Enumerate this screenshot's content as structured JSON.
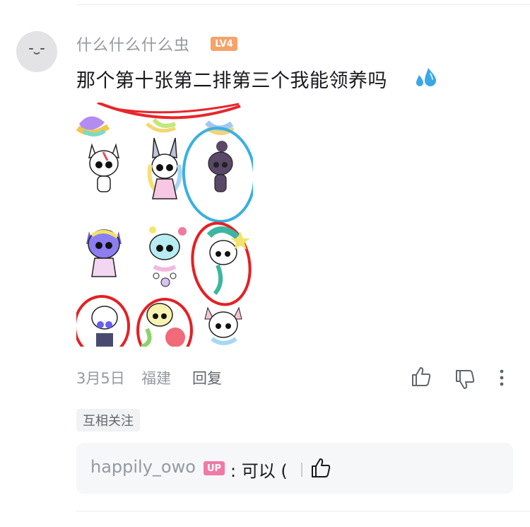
{
  "comment": {
    "username": "什么什么什么虫",
    "level_badge": "LV4",
    "text": "那个第十张第二排第三个我能领养吗",
    "emoji": "sweat-droplets",
    "date": "3月5日",
    "location": "福建",
    "reply_label": "回复",
    "tag": "互相关注"
  },
  "reply": {
    "username": "happily_owo",
    "badge": "UP",
    "text": ": 可以 ("
  },
  "colors": {
    "level_badge": "#f6a268",
    "up_badge": "#f07aa5",
    "muted_text": "#9499a0"
  }
}
